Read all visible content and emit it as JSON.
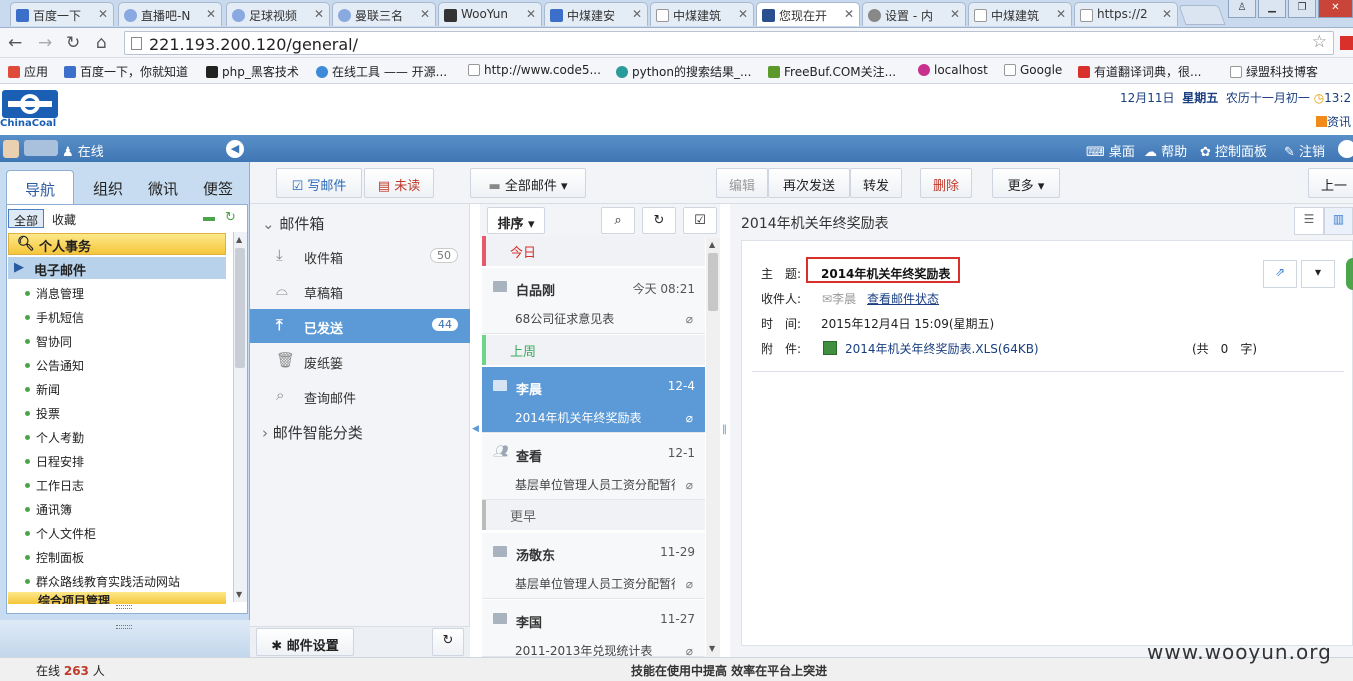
{
  "browser": {
    "tabs": [
      "百度一下",
      "直播吧-N",
      "足球视频",
      "曼联三名",
      "WooYun",
      "中煤建安",
      "中煤建筑",
      "您现在开",
      "设置 - 内",
      "中煤建筑",
      "https://2"
    ],
    "url": "221.193.200.120/general/",
    "bookmarks": [
      "应用",
      "百度一下，你就知道",
      "php_黑客技术",
      "在线工具 —— 开源...",
      "http://www.code5...",
      "python的搜索结果_...",
      "FreeBuf.COM关注...",
      "localhost",
      "Google",
      "有道翻译词典，很...",
      "绿盟科技博客"
    ]
  },
  "oa": {
    "logo_text": "ChinaCoal",
    "date": "12月11日",
    "weekday": "星期五",
    "lunar": "农历十一月初一",
    "clock": "13:2",
    "zixun": "资讯",
    "status": "在线",
    "topnav": [
      "桌面",
      "帮助",
      "控制面板",
      "注销"
    ]
  },
  "left": {
    "tabs": [
      "导航",
      "组织",
      "微讯",
      "便签"
    ],
    "filter": [
      "全部",
      "收藏"
    ],
    "group": "个人事务",
    "active_item": "电子邮件",
    "items": [
      "消息管理",
      "手机短信",
      "智协同",
      "公告通知",
      "新闻",
      "投票",
      "个人考勤",
      "日程安排",
      "工作日志",
      "通讯簿",
      "个人文件柜",
      "控制面板",
      "群众路线教育实践活动网站"
    ],
    "group2": "综合项目管理"
  },
  "toolbar": {
    "compose": "写邮件",
    "unread": "未读",
    "allmail": "全部邮件",
    "edit": "编辑",
    "resend": "再次发送",
    "forward": "转发",
    "delete": "删除",
    "more": "更多",
    "prev": "上一"
  },
  "folders": {
    "header": "邮件箱",
    "inbox": "收件箱",
    "inbox_count": "50",
    "drafts": "草稿箱",
    "sent": "已发送",
    "sent_count": "44",
    "trash": "废纸篓",
    "query": "查询邮件",
    "smart": "邮件智能分类",
    "settings": "邮件设置"
  },
  "list": {
    "sort": "排序",
    "sections": [
      "今日",
      "上周",
      "更早"
    ],
    "messages": [
      {
        "from": "白品刚",
        "time": "今天 08:21",
        "subject": "68公司征求意见表"
      },
      {
        "from": "李晨",
        "time": "12-4",
        "subject": "2014年机关年终奖励表"
      },
      {
        "from": "查看",
        "time": "12-1",
        "subject": "基层单位管理人员工资分配暂行"
      },
      {
        "from": "汤敬东",
        "time": "11-29",
        "subject": "基层单位管理人员工资分配暂行"
      },
      {
        "from": "李国",
        "time": "11-27",
        "subject": "2011-2013年兑现统计表"
      }
    ]
  },
  "reader": {
    "title": "2014年机关年终奖励表",
    "subject_label": "主　题:",
    "subject": "2014年机关年终奖励表",
    "to_label": "收件人:",
    "to": "李晨",
    "status_link": "查看邮件状态",
    "time_label": "时　间:",
    "time": "2015年12月4日 15:09(星期五)",
    "attach_label": "附　件:",
    "attachment": "2014年机关年终奖励表.XLS(64KB)",
    "wordcount": "(共　0　字)"
  },
  "footer": {
    "online_label": "在线",
    "online_count": "263",
    "online_unit": "人",
    "slogan": "技能在使用中提高  效率在平台上突进",
    "watermark": "www.wooyun.org"
  }
}
